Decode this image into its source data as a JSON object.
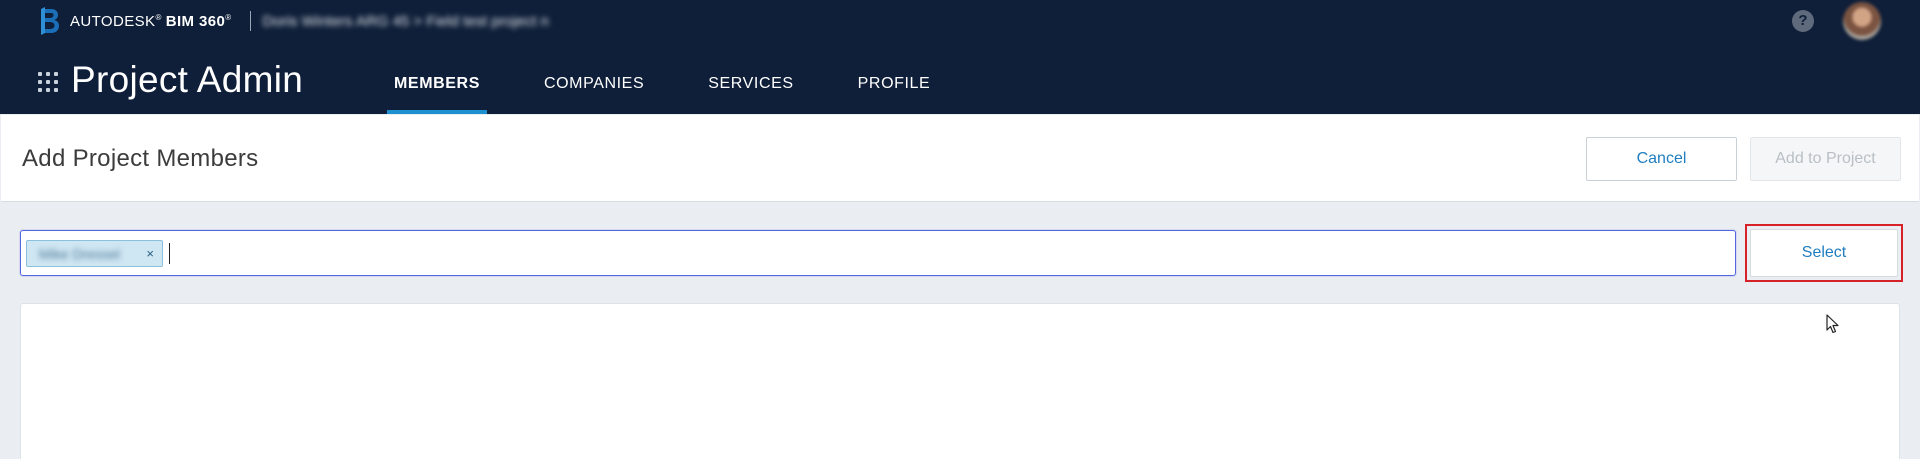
{
  "header": {
    "brand_name": "AUTODESK",
    "brand_mark": "®",
    "product_name": "BIM 360",
    "product_mark": "®",
    "project_name": "Doris Winters ARG 45 > Field test project n",
    "help_icon": "help-icon",
    "avatar_icon": "user-avatar",
    "apps_icon": "apps-grid-icon"
  },
  "app": {
    "title": "Project Admin"
  },
  "nav": {
    "tabs": [
      {
        "label": "MEMBERS",
        "active": true
      },
      {
        "label": "COMPANIES",
        "active": false
      },
      {
        "label": "SERVICES",
        "active": false
      },
      {
        "label": "PROFILE",
        "active": false
      }
    ]
  },
  "page": {
    "title": "Add Project Members",
    "cancel_label": "Cancel",
    "add_label": "Add to Project",
    "add_enabled": false
  },
  "member_input": {
    "chip_text": "Mike Dressel",
    "chip_remove": "×",
    "value": ""
  },
  "select_button": {
    "label": "Select",
    "highlighted": true
  },
  "colors": {
    "header_bg": "#0f1f39",
    "accent": "#1d91d0",
    "link": "#1f7ec1",
    "highlight": "#d62128"
  }
}
